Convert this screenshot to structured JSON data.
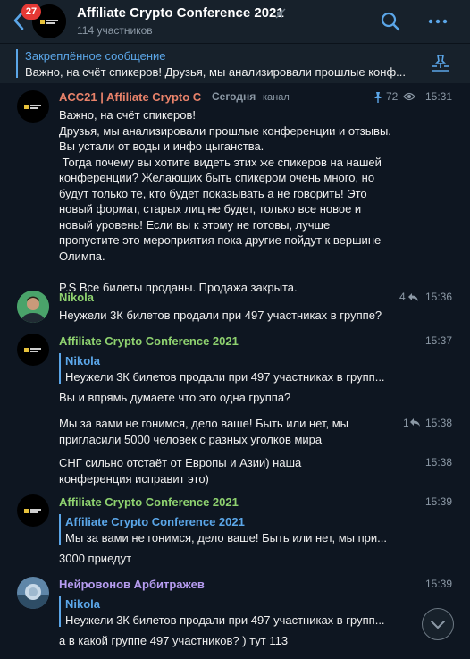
{
  "header": {
    "badge_count": "27",
    "title": "Affiliate Crypto Conference 2021",
    "members": "114 участников"
  },
  "pinned": {
    "title": "Закреплённое сообщение",
    "text": "Важно, на счёт спикеров! Друзья, мы анализировали прошлые конф..."
  },
  "messages": [
    {
      "author": "ACC21 | Affiliate Crypto C",
      "source_label": "Сегодня",
      "channel": "канал",
      "views": "72",
      "time": "15:31",
      "text": "Важно, на счёт спикеров!\nДрузья, мы анализировали прошлые конференции и отзывы.\nВы устали от воды и инфо цыганства.\n Тогда почему вы хотите видеть этих же спикеров на нашей\nконференции? Желающих быть спикером очень много, но\nбудут только те, кто будет показывать а не говорить! Это\nновый формат, старых лиц не будет, только все новое и\nновый уровень! Если вы к этому не готовы, лучше\nпропустите это мероприятия пока другие пойдут к вершине\nОлимпа.\n\nP.S Все билеты проданы. Продажа закрыта."
    },
    {
      "author": "Nikola",
      "replies": "4",
      "time": "15:36",
      "text": "Неужели 3К билетов продали при 497 участниках в группе?"
    },
    {
      "author": "Affiliate Crypto Conference 2021",
      "time": "15:37",
      "reply_name": "Nikola",
      "reply_text": "Неужели 3К билетов продали при 497 участниках в групп...",
      "text": "Вы и впрямь думаете что это одна группа?"
    },
    {
      "replies": "1",
      "time": "15:38",
      "text": "Мы за вами не гонимся, дело ваше! Быть или нет, мы\nпригласили 5000 человек с разных уголков мира"
    },
    {
      "time": "15:38",
      "text": "СНГ сильно отстаёт от Европы и Азии) наша\nконференция исправит это)"
    },
    {
      "author": "Affiliate Crypto Conference 2021",
      "time": "15:39",
      "reply_name": "Affiliate Crypto Conference 2021",
      "reply_text": "Мы за вами не гонимся, дело ваше! Быть или нет, мы при...",
      "text": "3000 приедут"
    },
    {
      "author": "Нейровонов Арбитражев",
      "time": "15:39",
      "reply_name": "Nikola",
      "reply_text": "Неужели 3К билетов продали при 497 участниках в групп...",
      "text": "а в какой группе 497 участников? ) тут 113"
    }
  ],
  "colors": {
    "background": "#0e1621",
    "panel": "#17212b",
    "accent": "#5ba6e8",
    "author_orange": "#e8826a",
    "author_green": "#8ed16f",
    "author_purple": "#b69cf0"
  },
  "icons": [
    "back-arrow-icon",
    "muted-icon",
    "search-icon",
    "more-icon",
    "pin-list-icon",
    "pin-icon",
    "views-icon",
    "reply-icon",
    "scroll-down-icon"
  ]
}
